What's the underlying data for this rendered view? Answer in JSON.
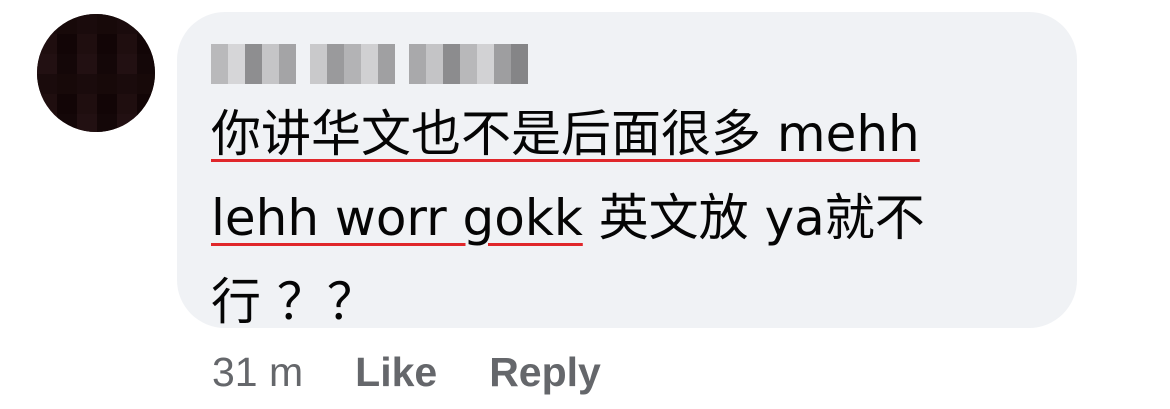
{
  "comment": {
    "author_name": "",
    "message_lines": [
      [
        {
          "text": "你讲华文也不是后面很多 mehh",
          "misspelled": true
        }
      ],
      [
        {
          "text": "lehh worr gokk",
          "misspelled": true
        },
        {
          "text": " 英文放 ya就不",
          "misspelled": false
        }
      ],
      [
        {
          "text": "行 ？？",
          "misspelled": false
        }
      ]
    ],
    "timestamp": "31 m",
    "like_label": "Like",
    "reply_label": "Reply"
  },
  "colors": {
    "bubble_bg": "#f0f2f5",
    "text": "#050505",
    "meta_text": "#65676b",
    "spellcheck_underline": "#e0272b",
    "avatar": "#1a0b0c"
  }
}
